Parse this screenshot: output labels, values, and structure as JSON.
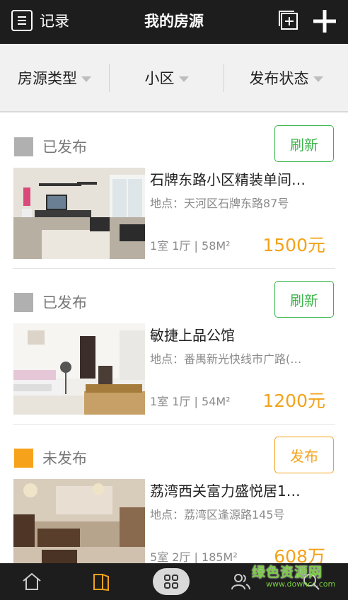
{
  "header": {
    "record_label": "记录",
    "title": "我的房源"
  },
  "filters": [
    {
      "label": "房源类型"
    },
    {
      "label": "小区"
    },
    {
      "label": "发布状态"
    }
  ],
  "listings": [
    {
      "status": "已发布",
      "action": "刷新",
      "title": "石牌东路小区精装单间…",
      "address": "地点：天河区石牌东路87号",
      "spec": "1室 1厅 | 58M²",
      "price": "1500元"
    },
    {
      "status": "已发布",
      "action": "刷新",
      "title": "敏捷上品公馆",
      "address": "地点：番禺新光快线市广路(…",
      "spec": "1室 1厅 | 54M²",
      "price": "1200元"
    },
    {
      "status": "未发布",
      "action": "发布",
      "title": "荔湾西关富力盛悦居1…",
      "address": "地点：荔湾区逢源路145号",
      "spec": "5室 2厅 | 185M²",
      "price": "608万"
    }
  ],
  "colors": {
    "published": "#b0b0b0",
    "unpublished": "#f7a21b",
    "refresh": "#3bb54a",
    "publish": "#f3a21a",
    "price": "#f3a21a",
    "bar": "#1d1d1d"
  },
  "icons": {
    "record": "list-icon",
    "copy": "add-copy-icon",
    "add": "plus-icon",
    "tabs": [
      "home-icon",
      "book-icon",
      "grid-icon",
      "users-icon",
      "search-icon"
    ]
  },
  "watermark": {
    "line1": "绿色资源网",
    "line2": "www.downcc.com"
  }
}
